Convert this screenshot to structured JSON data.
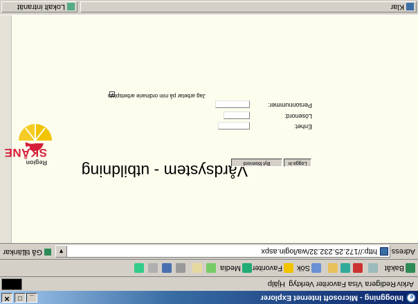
{
  "window": {
    "title": "Inloggning - Microsoft Internet Explorer",
    "minimize_glyph": "_",
    "maximize_glyph": "□",
    "close_glyph": "✕"
  },
  "menu": {
    "items": [
      "Arkiv",
      "Redigera",
      "Visa",
      "Favoriter",
      "Verktyg",
      "Hjälp"
    ]
  },
  "toolbar": {
    "back": "Bakåt",
    "search": "Sök",
    "favorites": "Favoriter",
    "media": "Media"
  },
  "address": {
    "label": "Adress",
    "url": "http://172.25.232.32/wa/login.aspx",
    "go": "Gå till",
    "links": "Länkar"
  },
  "page": {
    "heading": "Vårdsystem - utbildning",
    "logo_top": "Region",
    "logo_name": "SKÅNE",
    "fields": {
      "personnummer": "Personnummer:",
      "losenord": "Lösenord:",
      "enhet": "Enhet:"
    },
    "checkbox_label": "Jag arbetar på min ordinarie arbetsplats",
    "checkbox_checked": true,
    "buttons": {
      "login": "Logga in",
      "change_password": "Byt lösenord"
    }
  },
  "status": {
    "left": "Klar",
    "zone": "Lokalt intranät"
  },
  "colors": {
    "content_bg": "#fdfdee",
    "brand_red": "#d51f3a",
    "brand_yellow": "#f2c300"
  }
}
